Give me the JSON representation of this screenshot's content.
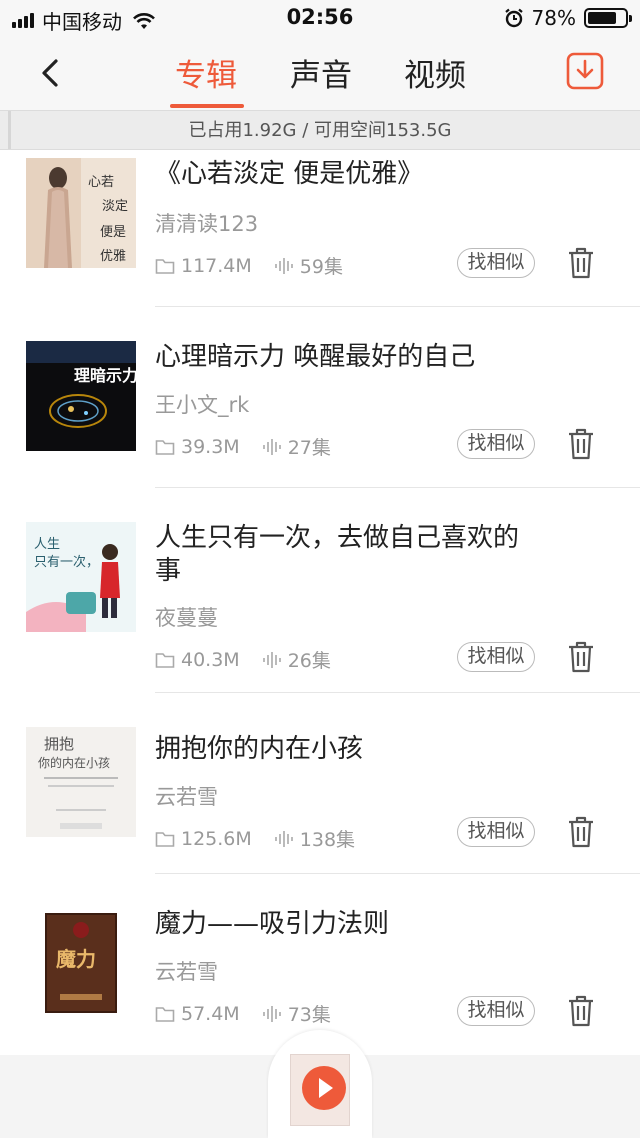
{
  "status": {
    "carrier": "中国移动",
    "time": "02:56",
    "battery": "78%",
    "battery_level": 0.78
  },
  "nav": {
    "tabs": [
      "专辑",
      "声音",
      "视频"
    ],
    "active_tab": 0
  },
  "storage_text": "已占用1.92G / 可用空间153.5G",
  "items": [
    {
      "title": "《心若淡定 便是优雅》",
      "author": "清清读123",
      "size": "117.4M",
      "episodes": "59集",
      "similar": "找相似"
    },
    {
      "title": "心理暗示力 唤醒最好的自己",
      "author": "王小文_rk",
      "size": "39.3M",
      "episodes": "27集",
      "similar": "找相似"
    },
    {
      "title": "人生只有一次，去做自己喜欢的事",
      "author": "夜蔓蔓",
      "size": "40.3M",
      "episodes": "26集",
      "similar": "找相似"
    },
    {
      "title": "拥抱你的内在小孩",
      "author": "云若雪",
      "size": "125.6M",
      "episodes": "138集",
      "similar": "找相似"
    },
    {
      "title": "魔力——吸引力法则",
      "author": "云若雪",
      "size": "57.4M",
      "episodes": "73集",
      "similar": "找相似"
    }
  ],
  "colors": {
    "accent": "#ee5a3a"
  },
  "icons": {
    "back": "back-arrow-icon",
    "download": "download-icon",
    "folder": "folder-icon",
    "audio": "audio-wave-icon",
    "trash": "trash-icon",
    "play": "play-icon"
  }
}
